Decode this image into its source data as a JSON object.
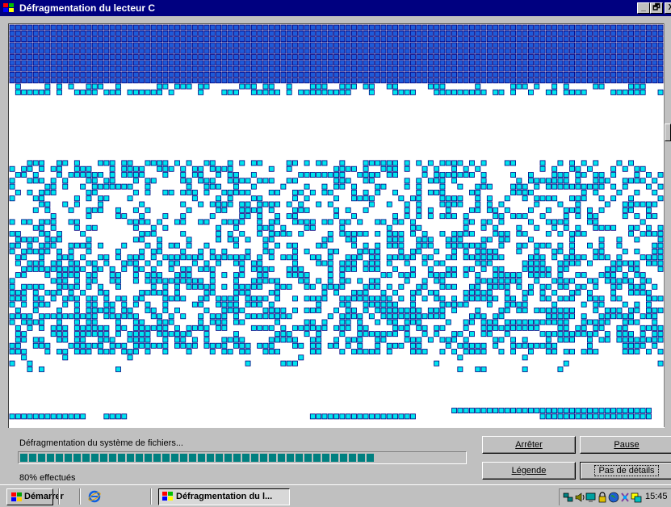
{
  "window": {
    "title": "Défragmentation du lecteur C",
    "buttons": {
      "minimize": "_",
      "restore": "🗗",
      "close": "X"
    }
  },
  "colors": {
    "title_bar": "#000080",
    "optimized_cluster": "#1e5bd8",
    "fragment_cluster": "#00e5ee",
    "cluster_border": "#000080",
    "progress_fill": "#008080"
  },
  "status": {
    "label": "Défragmentation du système de fichiers...",
    "progress_text": "80% effectués",
    "progress_fraction": 0.8
  },
  "actions": {
    "stop": "Arrêter",
    "pause": "Pause",
    "legend": "Légende",
    "details": "Pas de détails"
  },
  "taskbar": {
    "start": "Démarrer",
    "task": "Défragmentation du l...",
    "clock": "15:45"
  },
  "icons": {
    "title": "defrag-icon",
    "start": "windows-logo-icon",
    "quick_launch": "internet-explorer-icon",
    "tray": [
      "network-icon",
      "volume-icon",
      "monitor-icon",
      "lock-icon",
      "globe-icon",
      "scheduler-icon",
      "display-icon"
    ]
  }
}
